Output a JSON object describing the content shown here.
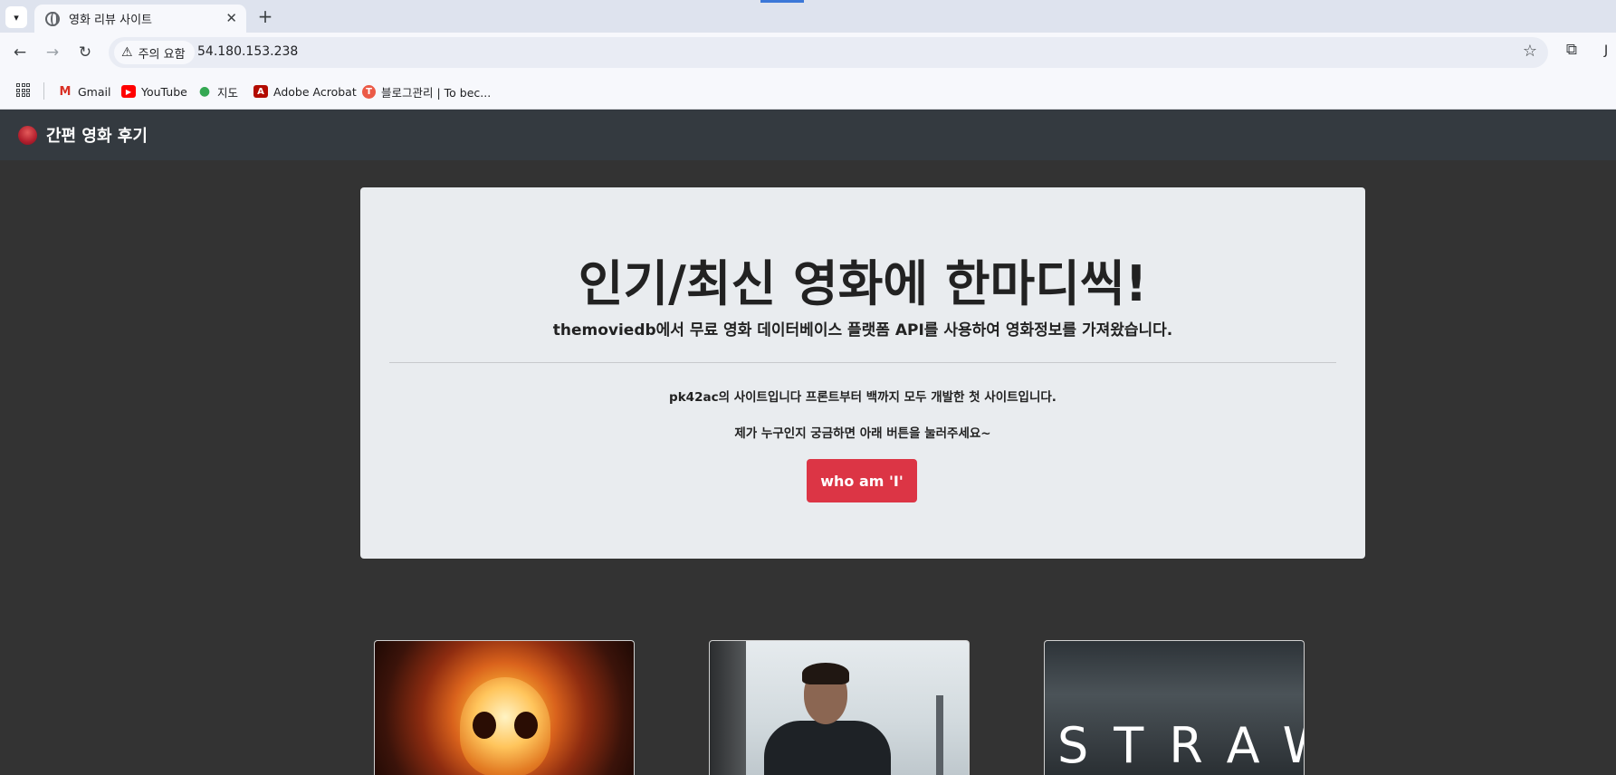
{
  "browser": {
    "tab_title": "영화 리뷰 사이트",
    "security_label": "주의 요함",
    "url": "54.180.153.238",
    "bookmarks": [
      {
        "label": "Gmail",
        "icon": "gmail-icon"
      },
      {
        "label": "YouTube",
        "icon": "youtube-icon"
      },
      {
        "label": "지도",
        "icon": "maps-icon"
      },
      {
        "label": "Adobe Acrobat",
        "icon": "acrobat-icon"
      },
      {
        "label": "블로그관리 | To bec...",
        "icon": "tistory-icon"
      }
    ],
    "profile_initial": "J"
  },
  "site": {
    "brand": "간편 영화 후기",
    "hero": {
      "title": "인기/최신 영화에 한마디씩!",
      "subtitle": "themoviedb에서 무료 영화 데이터베이스 플랫폼 API를 사용하여 영화정보를 가져왔습니다.",
      "text1": "pk42ac의 사이트입니다 프론트부터 백까지 모두 개발한 첫 사이트입니다.",
      "text2": "제가 누구인지 궁금하면 아래 버튼을 눌러주세요~",
      "button": "who am 'I'"
    },
    "cards": [
      {
        "poster": "burning-skull-poster"
      },
      {
        "poster": "man-in-city-poster"
      },
      {
        "poster_text": "STRAW"
      }
    ]
  },
  "colors": {
    "navbar": "#343a40",
    "page_bg": "#333333",
    "jumbotron": "#e9ecef",
    "button": "#dc3545"
  }
}
